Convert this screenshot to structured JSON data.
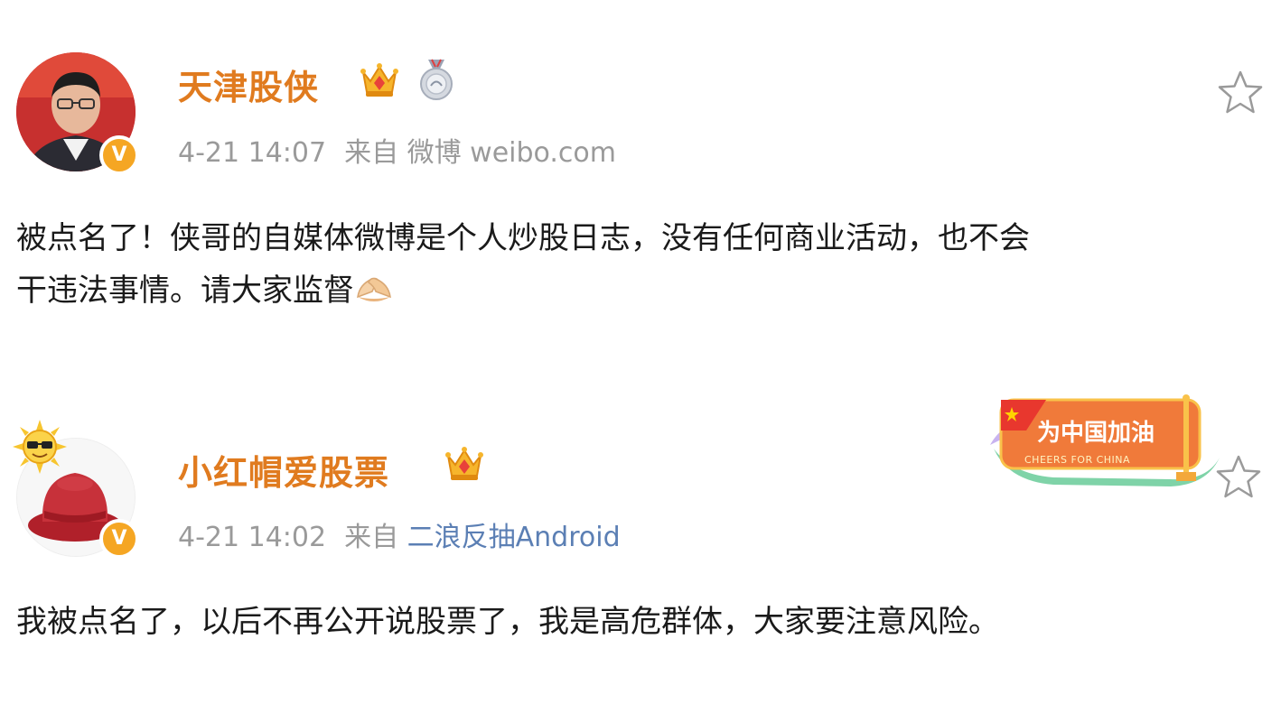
{
  "posts": [
    {
      "author": "天津股侠",
      "verified_badge": "V",
      "icons": [
        "crown-icon",
        "medal-icon",
        "star-outline-icon"
      ],
      "date": "4-21 14:07",
      "source_prefix": "来自",
      "source": "微博 weibo.com",
      "text_line1": "被点名了！侠哥的自媒体微博是个人炒股日志，没有任何商业活动，也不会",
      "text_line2": "干违法事情。请大家监督",
      "text_emoji": "hands-emoji"
    },
    {
      "author": "小红帽爱股票",
      "verified_badge": "V",
      "icons": [
        "crown-icon",
        "star-outline-icon"
      ],
      "date": "4-21 14:02",
      "source_prefix": "来自",
      "source": "二浪反抽Android",
      "text_line1": "我被点名了，以后不再公开说股票了，我是高危群体，大家要注意风险。",
      "banner": {
        "title": "为中国加油",
        "subtitle": "CHEERS FOR CHINA"
      }
    }
  ],
  "colors": {
    "name": "#e07b1f",
    "meta": "#9a9a9a",
    "link": "#5b7fb4",
    "text": "#1a1a1a",
    "badge": "#f5a623"
  }
}
